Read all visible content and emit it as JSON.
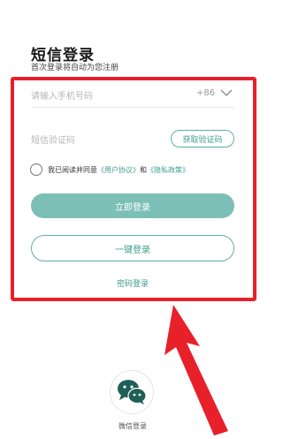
{
  "header": {
    "title": "短信登录",
    "subtitle": "首次登录将自动为您注册"
  },
  "form": {
    "phone_placeholder": "请输入手机号码",
    "country_code": "+86",
    "code_placeholder": "短信验证码",
    "get_code_label": "获取验证码",
    "agreement": {
      "prefix": "我已阅读并同意",
      "user_agreement": "《用户协议》",
      "and": "和",
      "privacy_policy": "《隐私政策》"
    },
    "login_label": "立即登录",
    "onekey_label": "一键登录",
    "password_login_label": "密码登录"
  },
  "social": {
    "wechat_label": "微信登录",
    "wechat_icon": "wechat-icon"
  },
  "annotation": {
    "box_color": "#e8202a",
    "arrow_color": "#e8202a"
  },
  "colors": {
    "accent": "#3f9d90",
    "button_fill": "#7cbfb7"
  }
}
